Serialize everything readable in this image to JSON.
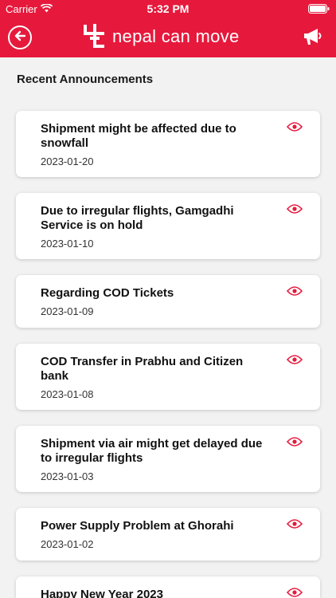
{
  "status_bar": {
    "carrier": "Carrier",
    "time": "5:32 PM"
  },
  "header": {
    "brand_name": "nepal can move"
  },
  "section_title": "Recent Announcements",
  "announcements": [
    {
      "title": "Shipment might be affected due to snowfall",
      "date": "2023-01-20"
    },
    {
      "title": "Due to irregular flights, Gamgadhi Service is on hold",
      "date": "2023-01-10"
    },
    {
      "title": "Regarding COD Tickets",
      "date": "2023-01-09"
    },
    {
      "title": "COD Transfer in Prabhu and Citizen bank",
      "date": "2023-01-08"
    },
    {
      "title": "Shipment via air might get delayed due to irregular flights",
      "date": "2023-01-03"
    },
    {
      "title": "Power Supply Problem at Ghorahi",
      "date": "2023-01-02"
    },
    {
      "title": "Happy New Year 2023",
      "date": ""
    }
  ],
  "colors": {
    "brand_red": "#e6193c",
    "background": "#f2f2f2",
    "card": "#ffffff"
  },
  "icons": [
    "wifi-icon",
    "battery-icon",
    "back-arrow-icon",
    "brand-logo-icon",
    "megaphone-icon",
    "eye-icon"
  ]
}
